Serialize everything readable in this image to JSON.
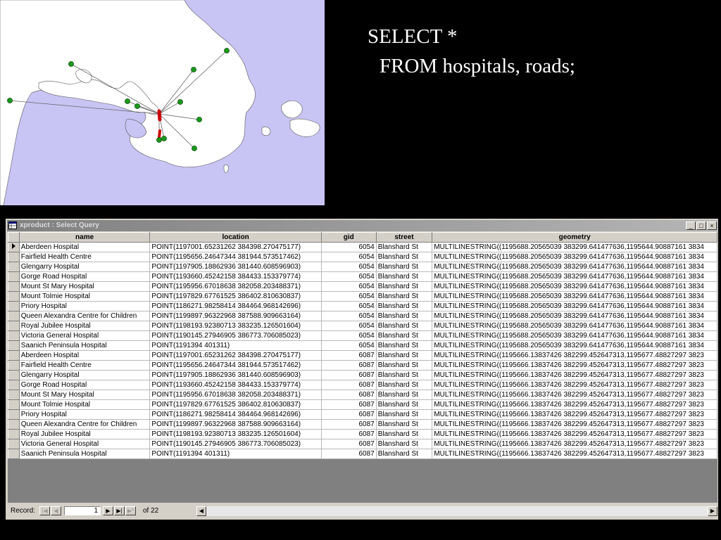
{
  "slide": {
    "sql_line1": "SELECT *",
    "sql_line2": "FROM hospitals, roads;"
  },
  "map": {
    "water_color": "#c8c4f4",
    "land_color": "#ffffff",
    "hospital_marker_color": "#1a9a1a",
    "road_color": "#cc0000"
  },
  "window": {
    "title": "xproduct : Select Query",
    "minimize": "_",
    "restore": "□",
    "close": "×"
  },
  "grid": {
    "columns": [
      "name",
      "location",
      "gid",
      "street",
      "geometry"
    ],
    "rows": [
      [
        "Aberdeen Hospital",
        "POINT(1197001.65231262 384398.270475177)",
        "6054",
        "Blanshard St",
        "MULTILINESTRING((1195688.20565039 383299.641477636,1195644.90887161 3834"
      ],
      [
        "Fairfield Health Centre",
        "POINT(1195656.24647344 381944.573517462)",
        "6054",
        "Blanshard St",
        "MULTILINESTRING((1195688.20565039 383299.641477636,1195644.90887161 3834"
      ],
      [
        "Glengarry Hospital",
        "POINT(1197905.18862936 381440.608596903)",
        "6054",
        "Blanshard St",
        "MULTILINESTRING((1195688.20565039 383299.641477636,1195644.90887161 3834"
      ],
      [
        "Gorge Road Hospital",
        "POINT(1193660.45242158 384433.153379774)",
        "6054",
        "Blanshard St",
        "MULTILINESTRING((1195688.20565039 383299.641477636,1195644.90887161 3834"
      ],
      [
        "Mount St Mary Hospital",
        "POINT(1195956.67018638 382058.203488371)",
        "6054",
        "Blanshard St",
        "MULTILINESTRING((1195688.20565039 383299.641477636,1195644.90887161 3834"
      ],
      [
        "Mount Tolmie Hospital",
        "POINT(1197829.67761525 386402.810630837)",
        "6054",
        "Blanshard St",
        "MULTILINESTRING((1195688.20565039 383299.641477636,1195644.90887161 3834"
      ],
      [
        "Priory Hospital",
        "POINT(1186271.98258414 384464.968142696)",
        "6054",
        "Blanshard St",
        "MULTILINESTRING((1195688.20565039 383299.641477636,1195644.90887161 3834"
      ],
      [
        "Queen Alexandra Centre for Children",
        "POINT(1199897.96322968 387588.909663164)",
        "6054",
        "Blanshard St",
        "MULTILINESTRING((1195688.20565039 383299.641477636,1195644.90887161 3834"
      ],
      [
        "Royal Jubilee Hospital",
        "POINT(1198193.92380713 383235.126501604)",
        "6054",
        "Blanshard St",
        "MULTILINESTRING((1195688.20565039 383299.641477636,1195644.90887161 3834"
      ],
      [
        "Victoria General Hospital",
        "POINT(1190145.27946905 386773.706085023)",
        "6054",
        "Blanshard St",
        "MULTILINESTRING((1195688.20565039 383299.641477636,1195644.90887161 3834"
      ],
      [
        "Saanich Peninsula Hospital",
        "POINT(1191394 401311)",
        "6054",
        "Blanshard St",
        "MULTILINESTRING((1195688.20565039 383299.641477636,1195644.90887161 3834"
      ],
      [
        "Aberdeen Hospital",
        "POINT(1197001.65231262 384398.270475177)",
        "6087",
        "Blanshard St",
        "MULTILINESTRING((1195666.13837426 382299.452647313,1195677.48827297 3823"
      ],
      [
        "Fairfield Health Centre",
        "POINT(1195656.24647344 381944.573517462)",
        "6087",
        "Blanshard St",
        "MULTILINESTRING((1195666.13837426 382299.452647313,1195677.48827297 3823"
      ],
      [
        "Glengarry Hospital",
        "POINT(1197905.18862936 381440.608596903)",
        "6087",
        "Blanshard St",
        "MULTILINESTRING((1195666.13837426 382299.452647313,1195677.48827297 3823"
      ],
      [
        "Gorge Road Hospital",
        "POINT(1193660.45242158 384433.153379774)",
        "6087",
        "Blanshard St",
        "MULTILINESTRING((1195666.13837426 382299.452647313,1195677.48827297 3823"
      ],
      [
        "Mount St Mary Hospital",
        "POINT(1195956.67018638 382058.203488371)",
        "6087",
        "Blanshard St",
        "MULTILINESTRING((1195666.13837426 382299.452647313,1195677.48827297 3823"
      ],
      [
        "Mount Tolmie Hospital",
        "POINT(1197829.67761525 386402.810630837)",
        "6087",
        "Blanshard St",
        "MULTILINESTRING((1195666.13837426 382299.452647313,1195677.48827297 3823"
      ],
      [
        "Priory Hospital",
        "POINT(1186271.98258414 384464.968142696)",
        "6087",
        "Blanshard St",
        "MULTILINESTRING((1195666.13837426 382299.452647313,1195677.48827297 3823"
      ],
      [
        "Queen Alexandra Centre for Children",
        "POINT(1199897.96322968 387588.909663164)",
        "6087",
        "Blanshard St",
        "MULTILINESTRING((1195666.13837426 382299.452647313,1195677.48827297 3823"
      ],
      [
        "Royal Jubilee Hospital",
        "POINT(1198193.92380713 383235.126501604)",
        "6087",
        "Blanshard St",
        "MULTILINESTRING((1195666.13837426 382299.452647313,1195677.48827297 3823"
      ],
      [
        "Victoria General Hospital",
        "POINT(1190145.27946905 386773.706085023)",
        "6087",
        "Blanshard St",
        "MULTILINESTRING((1195666.13837426 382299.452647313,1195677.48827297 3823"
      ],
      [
        "Saanich Peninsula Hospital",
        "POINT(1191394 401311)",
        "6087",
        "Blanshard St",
        "MULTILINESTRING((1195666.13837426 382299.452647313,1195677.48827297 3823"
      ]
    ]
  },
  "navigation": {
    "record_label": "Record:",
    "current_record": "1",
    "of_label": "of",
    "total_records": "22",
    "first_icon": "first-record-icon",
    "prev_icon": "previous-record-icon",
    "next_icon": "next-record-icon",
    "last_icon": "last-record-icon",
    "new_icon": "new-record-icon"
  }
}
